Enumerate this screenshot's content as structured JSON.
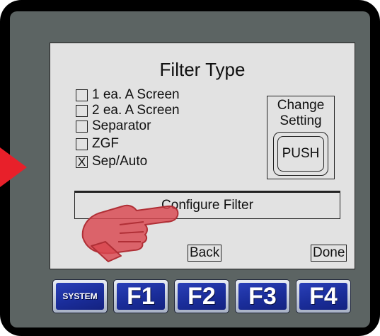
{
  "screen": {
    "title": "Filter Type",
    "options": [
      {
        "label": "1 ea. A Screen",
        "checked": false,
        "mark": ""
      },
      {
        "label": "2 ea. A Screen",
        "checked": false,
        "mark": ""
      },
      {
        "label": "Separator",
        "checked": false,
        "mark": ""
      },
      {
        "label": "ZGF",
        "checked": false,
        "mark": ""
      },
      {
        "label": "Sep/Auto",
        "checked": true,
        "mark": "X"
      }
    ],
    "change_setting": {
      "line1": "Change",
      "line2": "Setting",
      "push_label": "PUSH"
    },
    "configure_label": "Configure Filter",
    "back_label": "Back",
    "done_label": "Done"
  },
  "function_keys": [
    {
      "label": "SYSTEM"
    },
    {
      "label": "F1"
    },
    {
      "label": "F2"
    },
    {
      "label": "F3"
    },
    {
      "label": "F4"
    }
  ],
  "colors": {
    "pointer_arrow": "#e8202a",
    "bezel": "#5c6463",
    "screen": "#e2e2e2",
    "key_blue": "#1a2d9a",
    "hand": "#d9474f"
  },
  "icons": {
    "pointer": "red-arrow-icon",
    "hand": "pointing-hand-icon"
  }
}
